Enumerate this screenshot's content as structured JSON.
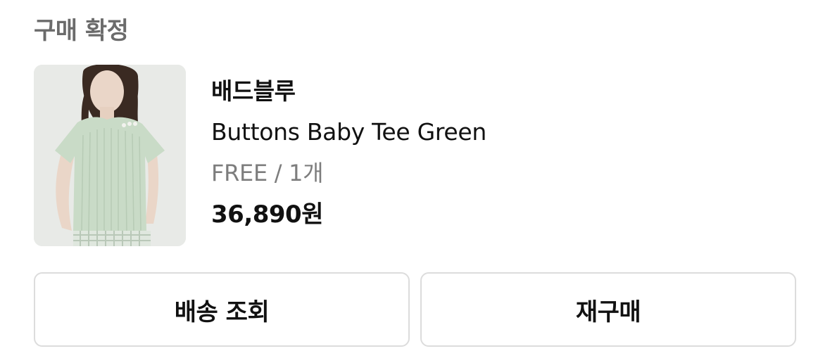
{
  "order": {
    "status_label": "구매 확정"
  },
  "product": {
    "image_alt": "Buttons Baby Tee Green product photo",
    "brand": "배드블루",
    "name": "Buttons Baby Tee Green",
    "option": "FREE / 1개",
    "price": "36,890원"
  },
  "actions": {
    "track_label": "배송 조회",
    "rebuy_label": "재구매"
  },
  "colors": {
    "status_text": "#6b6b6b",
    "option_text": "#7d7d7d",
    "button_border": "#dcdcdc",
    "tee_green": "#c9dbc7"
  }
}
